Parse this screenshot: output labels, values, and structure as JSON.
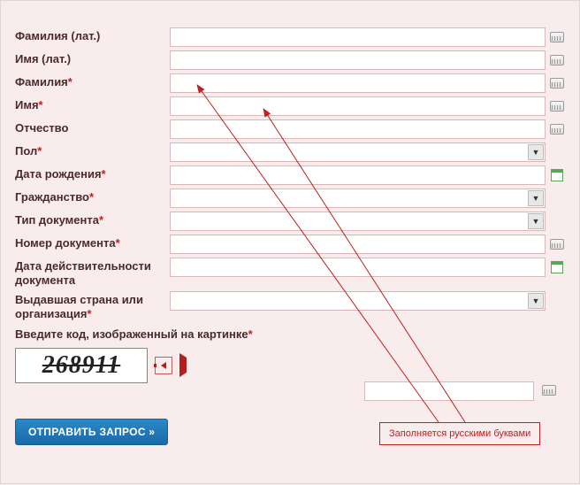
{
  "fields": {
    "surname_lat": {
      "label": "Фамилия (лат.)",
      "required": false,
      "type": "text"
    },
    "name_lat": {
      "label": "Имя (лат.)",
      "required": false,
      "type": "text"
    },
    "surname": {
      "label": "Фамилия",
      "required": true,
      "type": "text"
    },
    "name": {
      "label": "Имя",
      "required": true,
      "type": "text"
    },
    "patronymic": {
      "label": "Отчество",
      "required": false,
      "type": "text"
    },
    "gender": {
      "label": "Пол",
      "required": true,
      "type": "select"
    },
    "dob": {
      "label": "Дата рождения",
      "required": true,
      "type": "date"
    },
    "citizenship": {
      "label": "Гражданство",
      "required": true,
      "type": "select"
    },
    "doc_type": {
      "label": "Тип документа",
      "required": true,
      "type": "select"
    },
    "doc_number": {
      "label": "Номер документа",
      "required": true,
      "type": "text"
    },
    "doc_validity": {
      "label": "Дата действительности документа",
      "required": false,
      "type": "date"
    },
    "issuer": {
      "label": "Выдавшая страна или организация",
      "required": true,
      "type": "select"
    }
  },
  "captcha": {
    "label": "Введите код, изображенный на картинке",
    "required": true,
    "code": "268911"
  },
  "submit_label": "ОТПРАВИТЬ ЗАПРОС »",
  "annotation": "Заполняется русскими буквами"
}
